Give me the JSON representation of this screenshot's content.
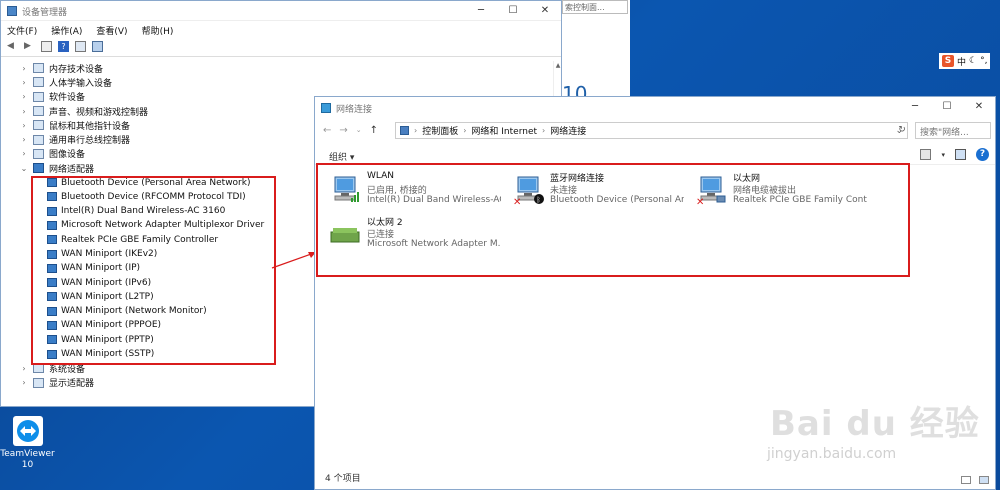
{
  "device_manager": {
    "title": "设备管理器",
    "menu": [
      "文件(F)",
      "操作(A)",
      "查看(V)",
      "帮助(H)"
    ],
    "categories_before": [
      "内存技术设备",
      "人体学输入设备",
      "软件设备",
      "声音、视频和游戏控制器",
      "鼠标和其他指针设备",
      "通用串行总线控制器",
      "图像设备"
    ],
    "expanded_category": "网络适配器",
    "adapters": [
      "Bluetooth Device (Personal Area Network)",
      "Bluetooth Device (RFCOMM Protocol TDI)",
      "Intel(R) Dual Band Wireless-AC 3160",
      "Microsoft Network Adapter Multiplexor Driver",
      "Realtek PCIe GBE Family Controller",
      "WAN Miniport (IKEv2)",
      "WAN Miniport (IP)",
      "WAN Miniport (IPv6)",
      "WAN Miniport (L2TP)",
      "WAN Miniport (Network Monitor)",
      "WAN Miniport (PPPOE)",
      "WAN Miniport (PPTP)",
      "WAN Miniport (SSTP)"
    ],
    "categories_after": [
      "系统设备",
      "显示适配器"
    ]
  },
  "background_window": {
    "search_text": "索控制面...",
    "big_text": "10"
  },
  "network_connections": {
    "title": "网络连接",
    "breadcrumb": [
      "控制面板",
      "网络和 Internet",
      "网络连接"
    ],
    "search_placeholder": "搜索\"网络...",
    "organize": "组织 ▾",
    "connections": [
      {
        "name": "WLAN",
        "status": "已启用, 桥接的",
        "device": "Intel(R) Dual Band Wireless-AC...",
        "icon": "wifi-pc-icon"
      },
      {
        "name": "蓝牙网络连接",
        "status": "未连接",
        "device": "Bluetooth Device (Personal Ar...",
        "icon": "bluetooth-pc-icon"
      },
      {
        "name": "以太网",
        "status": "网络电缆被拔出",
        "device": "Realtek PCIe GBE Family Contr...",
        "icon": "ethernet-pc-icon"
      },
      {
        "name": "以太网 2",
        "status": "已连接",
        "device": "Microsoft Network Adapter M...",
        "icon": "bridge-icon"
      }
    ],
    "item_count": "4 个项目"
  },
  "ime": {
    "label": "中"
  },
  "teamviewer": {
    "line1": "TeamViewer",
    "line2": "10"
  },
  "watermark": {
    "text": "Bai du 经验",
    "url": "jingyan.baidu.com"
  },
  "colors": {
    "highlight_box": "#d91c1c",
    "desktop": "#0b4a9c"
  }
}
